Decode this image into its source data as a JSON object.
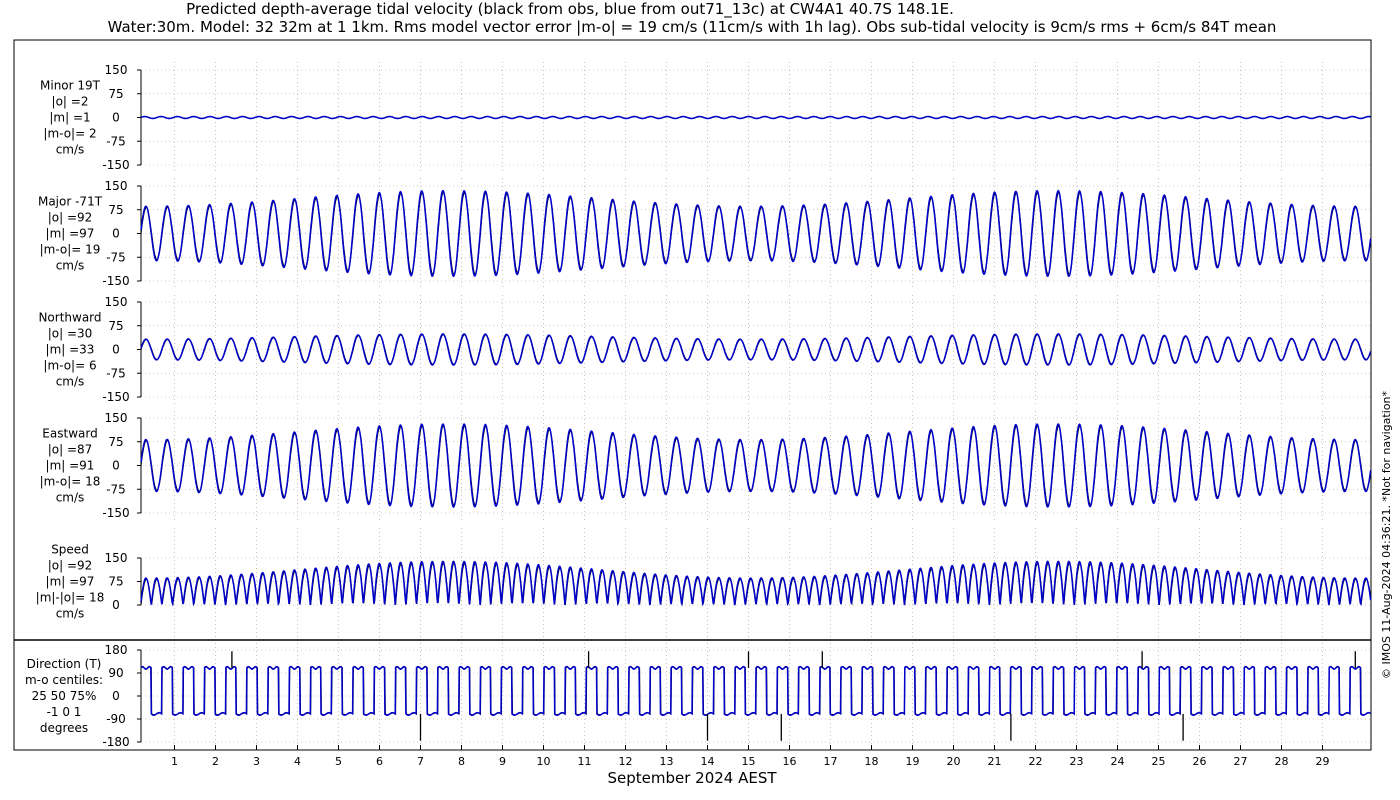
{
  "chart_data": {
    "type": "line",
    "title": "Predicted depth-average tidal velocity (black from obs, blue from out71_13c) at CW4A1 40.7S 148.1E.",
    "subtitle": "Water:30m. Model: 32 32m at 1 1km. Rms model vector error |m-o| = 19 cm/s (11cm/s with 1h lag). Obs sub-tidal velocity is 9cm/s rms + 6cm/s 84T mean",
    "xlabel": "September 2024 AEST",
    "x_ticks": [
      "1",
      "2",
      "3",
      "4",
      "5",
      "6",
      "7",
      "8",
      "9",
      "10",
      "11",
      "12",
      "13",
      "14",
      "15",
      "16",
      "17",
      "18",
      "19",
      "20",
      "21",
      "22",
      "23",
      "24",
      "25",
      "26",
      "27",
      "28",
      "29"
    ],
    "credit": "© IMOS 11-Aug-2024 04:36:21. *Not for navigation*",
    "colors": {
      "obs": "#000000",
      "model": "#0000cc"
    },
    "panels": [
      {
        "label": [
          "Minor 19T",
          "|o| =2",
          "|m| =1",
          "|m-o|= 2",
          "cm/s"
        ],
        "ylim": [
          -150,
          150
        ],
        "ticks": [
          "150",
          "75",
          "0",
          "-75",
          "-150"
        ],
        "amplitude": 3,
        "kind": "minor"
      },
      {
        "label": [
          "Major -71T",
          "|o| =92",
          "|m| =97",
          "|m-o|= 19",
          "cm/s"
        ],
        "ylim": [
          -150,
          150
        ],
        "ticks": [
          "150",
          "75",
          "0",
          "-75",
          "-150"
        ],
        "amplitude_range": [
          105,
          165
        ],
        "kind": "tidal"
      },
      {
        "label": [
          "Northward",
          "|o| =30",
          "|m| =33",
          "|m-o|= 6",
          "cm/s"
        ],
        "ylim": [
          -150,
          150
        ],
        "ticks": [
          "150",
          "75",
          "0",
          "-75",
          "-150"
        ],
        "amplitude_range": [
          40,
          60
        ],
        "kind": "tidal"
      },
      {
        "label": [
          "Eastward",
          "|o| =87",
          "|m| =91",
          "|m-o|= 18",
          "cm/s"
        ],
        "ylim": [
          -150,
          150
        ],
        "ticks": [
          "150",
          "75",
          "0",
          "-75",
          "-150"
        ],
        "amplitude_range": [
          100,
          160
        ],
        "kind": "tidal"
      },
      {
        "label": [
          "Speed",
          "|o| =92",
          "|m| =97",
          "|m|-|o|= 18",
          "cm/s"
        ],
        "ylim": [
          0,
          150
        ],
        "ticks": [
          "150",
          "75",
          "0"
        ],
        "amplitude_range": [
          105,
          170
        ],
        "kind": "speed"
      },
      {
        "label": [
          "Direction (T)",
          "m-o centiles:",
          "25  50  75%",
          "-1  0  1",
          "degrees"
        ],
        "ylim": [
          -180,
          180
        ],
        "ticks": [
          "180",
          "90",
          "0",
          "-90",
          "-180"
        ],
        "levels": [
          110,
          -70
        ],
        "kind": "direction"
      }
    ]
  }
}
